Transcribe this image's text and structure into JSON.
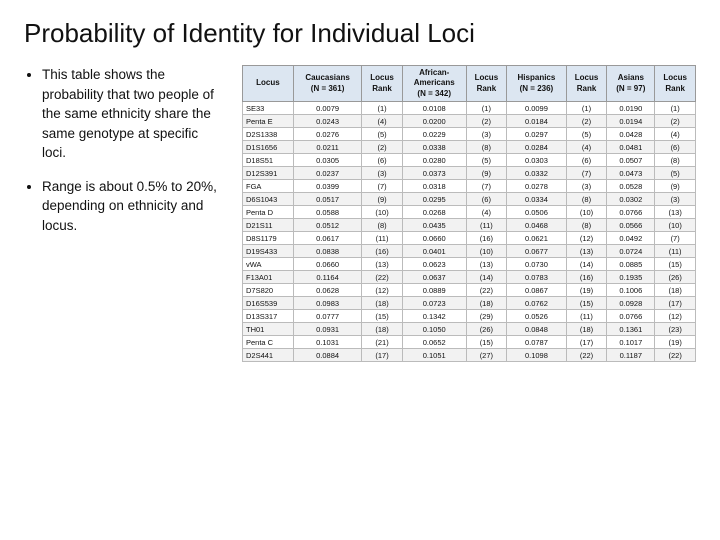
{
  "title": "Probability of Identity for Individual Loci",
  "bullets": [
    "This table shows the probability that two people of the same ethnicity share the same genotype at specific loci.",
    "Range is about 0.5% to 20%, depending on ethnicity and locus."
  ],
  "table": {
    "headers": [
      {
        "label": "Locus",
        "colspan": 1,
        "rowspan": 2
      },
      {
        "label": "Caucasians\n(N = 361)",
        "colspan": 1,
        "rowspan": 1
      },
      {
        "label": "Locus\nRank",
        "colspan": 1,
        "rowspan": 1
      },
      {
        "label": "African-\nAmericans\n(N = 342)",
        "colspan": 1,
        "rowspan": 1
      },
      {
        "label": "Locus\nRank",
        "colspan": 1,
        "rowspan": 1
      },
      {
        "label": "Hispanics\n(N = 236)",
        "colspan": 1,
        "rowspan": 1
      },
      {
        "label": "Locus\nRank",
        "colspan": 1,
        "rowspan": 1
      },
      {
        "label": "Asians\n(N = 97)",
        "colspan": 1,
        "rowspan": 1
      },
      {
        "label": "Locus\nRank",
        "colspan": 1,
        "rowspan": 1
      }
    ],
    "rows": [
      [
        "SE33",
        "0.0079",
        "(1)",
        "0.0108",
        "(1)",
        "0.0099",
        "(1)",
        "0.0190",
        "(1)"
      ],
      [
        "Penta E",
        "0.0243",
        "(4)",
        "0.0200",
        "(2)",
        "0.0184",
        "(2)",
        "0.0194",
        "(2)"
      ],
      [
        "D2S1338",
        "0.0276",
        "(5)",
        "0.0229",
        "(3)",
        "0.0297",
        "(5)",
        "0.0428",
        "(4)"
      ],
      [
        "D1S1656",
        "0.0211",
        "(2)",
        "0.0338",
        "(8)",
        "0.0284",
        "(4)",
        "0.0481",
        "(6)"
      ],
      [
        "D18S51",
        "0.0305",
        "(6)",
        "0.0280",
        "(5)",
        "0.0303",
        "(6)",
        "0.0507",
        "(8)"
      ],
      [
        "D12S391",
        "0.0237",
        "(3)",
        "0.0373",
        "(9)",
        "0.0332",
        "(7)",
        "0.0473",
        "(5)"
      ],
      [
        "FGA",
        "0.0399",
        "(7)",
        "0.0318",
        "(7)",
        "0.0278",
        "(3)",
        "0.0528",
        "(9)"
      ],
      [
        "D6S1043",
        "0.0517",
        "(9)",
        "0.0295",
        "(6)",
        "0.0334",
        "(8)",
        "0.0302",
        "(3)"
      ],
      [
        "Penta D",
        "0.0588",
        "(10)",
        "0.0268",
        "(4)",
        "0.0506",
        "(10)",
        "0.0766",
        "(13)"
      ],
      [
        "D21S11",
        "0.0512",
        "(8)",
        "0.0435",
        "(11)",
        "0.0468",
        "(8)",
        "0.0566",
        "(10)"
      ],
      [
        "D8S1179",
        "0.0617",
        "(11)",
        "0.0660",
        "(16)",
        "0.0621",
        "(12)",
        "0.0492",
        "(7)"
      ],
      [
        "D19S433",
        "0.0838",
        "(16)",
        "0.0401",
        "(10)",
        "0.0677",
        "(13)",
        "0.0724",
        "(11)"
      ],
      [
        "vWA",
        "0.0660",
        "(13)",
        "0.0623",
        "(13)",
        "0.0730",
        "(14)",
        "0.0885",
        "(15)"
      ],
      [
        "F13A01",
        "0.1164",
        "(22)",
        "0.0637",
        "(14)",
        "0.0783",
        "(16)",
        "0.1935",
        "(26)"
      ],
      [
        "D7S820",
        "0.0628",
        "(12)",
        "0.0889",
        "(22)",
        "0.0867",
        "(19)",
        "0.1006",
        "(18)"
      ],
      [
        "D16S539",
        "0.0983",
        "(18)",
        "0.0723",
        "(18)",
        "0.0762",
        "(15)",
        "0.0928",
        "(17)"
      ],
      [
        "D13S317",
        "0.0777",
        "(15)",
        "0.1342",
        "(29)",
        "0.0526",
        "(11)",
        "0.0766",
        "(12)"
      ],
      [
        "TH01",
        "0.0931",
        "(18)",
        "0.1050",
        "(26)",
        "0.0848",
        "(18)",
        "0.1361",
        "(23)"
      ],
      [
        "Penta C",
        "0.1031",
        "(21)",
        "0.0652",
        "(15)",
        "0.0787",
        "(17)",
        "0.1017",
        "(19)"
      ],
      [
        "D2S441",
        "0.0884",
        "(17)",
        "0.1051",
        "(27)",
        "0.1098",
        "(22)",
        "0.1187",
        "(22)"
      ]
    ]
  }
}
